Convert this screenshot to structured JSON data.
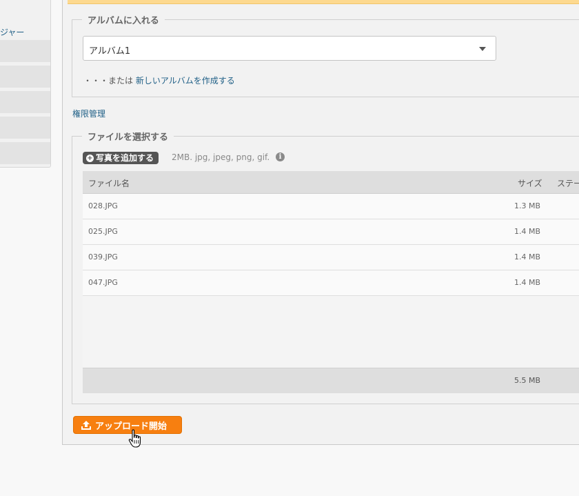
{
  "sidebar": {
    "link_partial": "ジャー"
  },
  "album": {
    "legend": "アルバムに入れる",
    "selected": "アルバム1",
    "or_prefix": "・・・または",
    "create_link": "新しいアルバムを作成する"
  },
  "permissions_link": "権限管理",
  "files": {
    "legend": "ファイルを選択する",
    "add_button": "写真を追加する",
    "hint": "2MB. jpg, jpeg, png, gif.",
    "info_icon": "i",
    "columns": {
      "name": "ファイル名",
      "size": "サイズ",
      "status": "ステー"
    },
    "rows": [
      {
        "name": "028.JPG",
        "size": "1.3 MB"
      },
      {
        "name": "025.JPG",
        "size": "1.4 MB"
      },
      {
        "name": "039.JPG",
        "size": "1.4 MB"
      },
      {
        "name": "047.JPG",
        "size": "1.4 MB"
      }
    ],
    "total": "5.5 MB"
  },
  "upload_button": "アップロード開始",
  "colors": {
    "accent": "#f77f10",
    "link": "#1f5f86",
    "notice": "#fdd98f"
  }
}
